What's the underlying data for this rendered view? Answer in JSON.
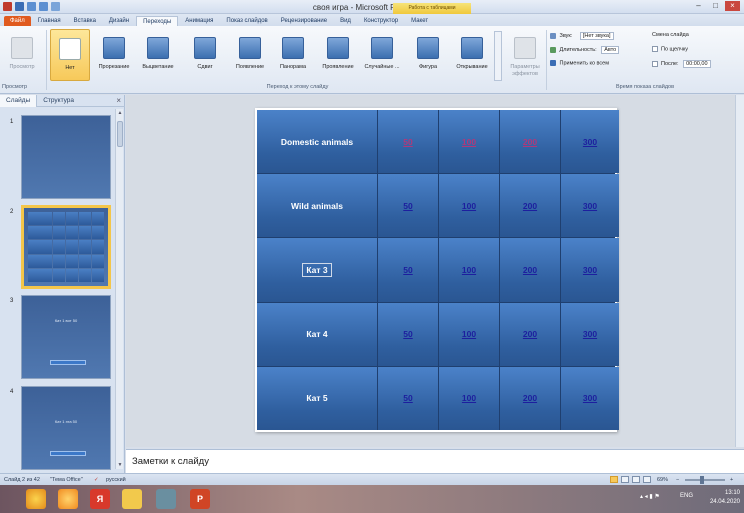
{
  "window": {
    "title": "своя игра - Microsoft PowerPoint",
    "context_tab": "Работа с таблицами",
    "minimize": "–",
    "maximize": "□",
    "close": "×"
  },
  "ribbon_tabs": [
    "Файл",
    "Главная",
    "Вставка",
    "Дизайн",
    "Переходы",
    "Анимация",
    "Показ слайдов",
    "Рецензирование",
    "Вид",
    "Конструктор",
    "Макет"
  ],
  "ribbon": {
    "preview_label": "Просмотр",
    "preview_group": "Просмотр",
    "transitions": [
      "Нет",
      "Прорезание",
      "Выцветание",
      "Сдвиг",
      "Появление",
      "Панорама",
      "Проявление",
      "Случайные ...",
      "Фигура",
      "Открывание"
    ],
    "transition_group": "Переход к этому слайду",
    "effect_params": "Параметры эффектов",
    "sound_label": "Звук:",
    "sound_value": "[Нет звука]",
    "duration_label": "Длительность:",
    "duration_value": "Авто",
    "apply_all": "Применить ко всем",
    "advance_label": "Смена слайда",
    "on_click": "По щелчку",
    "after_label": "После:",
    "after_value": "00:00,00",
    "timing_group": "Время показа слайдов"
  },
  "left_pane": {
    "tab_slides": "Слайды",
    "tab_outline": "Структура",
    "close": "×",
    "thumbs": [
      {
        "num": "1",
        "caption": ""
      },
      {
        "num": "2",
        "caption": ""
      },
      {
        "num": "3",
        "caption": "Кат 1 вот 50"
      },
      {
        "num": "4",
        "caption": "Кат 1 эта 50"
      }
    ]
  },
  "slide": {
    "rows": [
      {
        "category": "Domestic animals",
        "values": [
          "50",
          "100",
          "200",
          "300"
        ]
      },
      {
        "category": "Wild animals",
        "values": [
          "50",
          "100",
          "200",
          "300"
        ]
      },
      {
        "category": "Кат 3",
        "values": [
          "50",
          "100",
          "200",
          "300"
        ]
      },
      {
        "category": "Кат 4",
        "values": [
          "50",
          "100",
          "200",
          "300"
        ]
      },
      {
        "category": "Кат 5",
        "values": [
          "50",
          "100",
          "200",
          "300"
        ]
      }
    ]
  },
  "notes_placeholder": "Заметки к слайду",
  "status": {
    "slide_counter": "Слайд 2 из 42",
    "theme": "\"Тема Office\"",
    "language": "русский",
    "zoom": "69%"
  },
  "taskbar": {
    "lang": "ENG",
    "time": "13:10",
    "date": "24.04.2020"
  }
}
